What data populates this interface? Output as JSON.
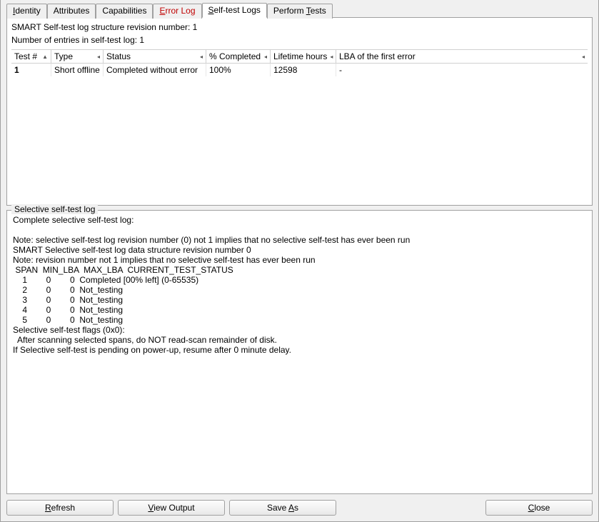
{
  "tabs": {
    "identity": "Identity",
    "attributes": "Attributes",
    "capabilities": "Capabilities",
    "errorlog": "Error Log",
    "selftest": "Self-test Logs",
    "perform": "Perform Tests"
  },
  "summary": {
    "line1": "SMART Self-test log structure revision number: 1",
    "line2": "Number of entries in self-test log: 1"
  },
  "headers": {
    "testnum": "Test #",
    "type": "Type",
    "status": "Status",
    "pct": "% Completed",
    "lifetime": "Lifetime hours",
    "lba": "LBA of the first error"
  },
  "row": {
    "testnum": "1",
    "type": "Short offline",
    "status": "Completed without error",
    "pct": "100%",
    "lifetime": "12598",
    "lba": "-"
  },
  "group": {
    "title": "Selective self-test log"
  },
  "log": "Complete selective self-test log:\n\nNote: selective self-test log revision number (0) not 1 implies that no selective self-test has ever been run\nSMART Selective self-test log data structure revision number 0\nNote: revision number not 1 implies that no selective self-test has ever been run\n SPAN  MIN_LBA  MAX_LBA  CURRENT_TEST_STATUS\n    1        0        0  Completed [00% left] (0-65535)\n    2        0        0  Not_testing\n    3        0        0  Not_testing\n    4        0        0  Not_testing\n    5        0        0  Not_testing\nSelective self-test flags (0x0):\n  After scanning selected spans, do NOT read-scan remainder of disk.\nIf Selective self-test is pending on power-up, resume after 0 minute delay.",
  "buttons": {
    "refresh": "Refresh",
    "view": "View Output",
    "saveas": "Save As",
    "close": "Close"
  },
  "accel": {
    "identity": "I",
    "errorlog": "E",
    "selftest": "S",
    "perform": "T",
    "refresh": "R",
    "view": "V",
    "saveas": "A",
    "close": "C"
  }
}
